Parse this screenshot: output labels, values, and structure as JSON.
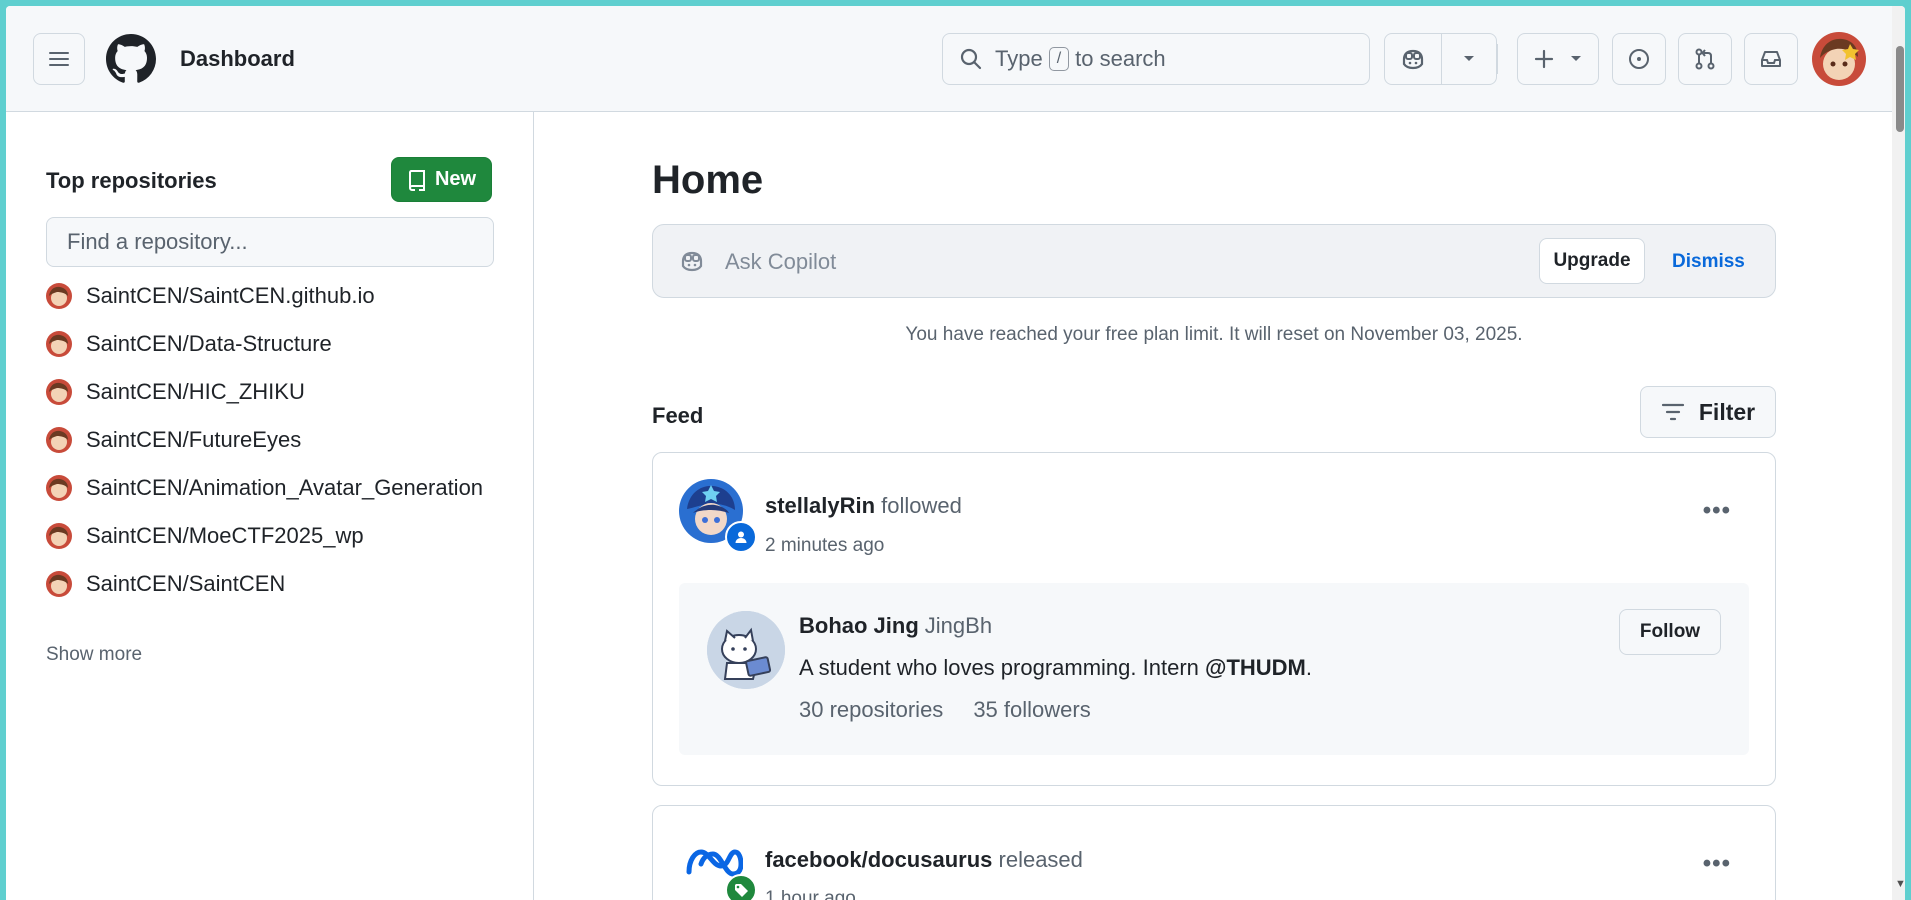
{
  "header": {
    "title": "Dashboard",
    "search_prefix": "Type",
    "search_key": "/",
    "search_suffix": "to search"
  },
  "sidebar": {
    "title": "Top repositories",
    "new_label": "New",
    "search_placeholder": "Find a repository...",
    "repos": [
      "SaintCEN/SaintCEN.github.io",
      "SaintCEN/Data-Structure",
      "SaintCEN/HIC_ZHIKU",
      "SaintCEN/FutureEyes",
      "SaintCEN/Animation_Avatar_Generation",
      "SaintCEN/MoeCTF2025_wp",
      "SaintCEN/SaintCEN"
    ],
    "show_more": "Show more"
  },
  "main": {
    "title": "Home",
    "copilot_placeholder": "Ask Copilot",
    "upgrade_label": "Upgrade",
    "dismiss_label": "Dismiss",
    "limit_message": "You have reached your free plan limit. It will reset on November 03, 2025.",
    "feed_title": "Feed",
    "filter_label": "Filter"
  },
  "feed": [
    {
      "actor": "stellalyRin",
      "action": "followed",
      "time": "2 minutes ago",
      "target": {
        "name": "Bohao Jing",
        "login": "JingBh",
        "bio_prefix": "A student who loves programming. Intern ",
        "bio_mention": "@THUDM",
        "bio_suffix": ".",
        "repositories": "30 repositories",
        "followers": "35 followers",
        "follow_label": "Follow"
      }
    },
    {
      "actor": "facebook/docusaurus",
      "action": "released",
      "time": "1 hour ago"
    }
  ],
  "colors": {
    "primary_button": "#1f883d",
    "link": "#0969da",
    "frame": "#5fcfcf"
  }
}
